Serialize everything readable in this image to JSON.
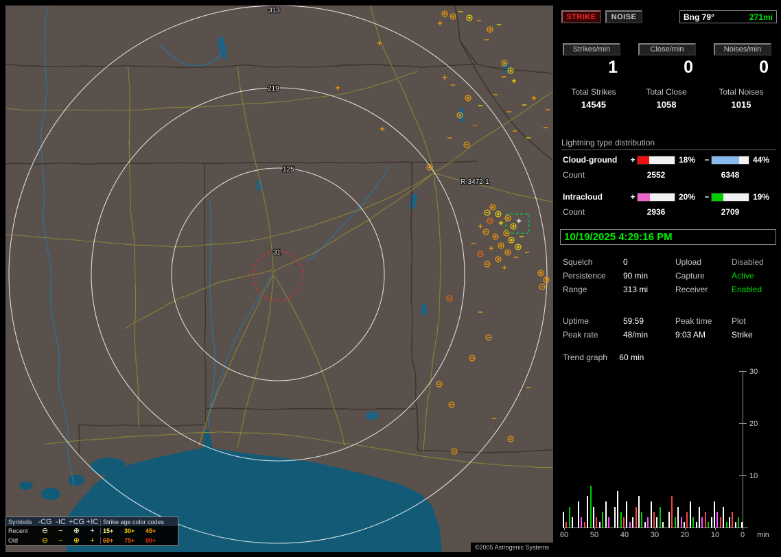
{
  "toolbar": {
    "strike_label": "STRIKE",
    "noise_label": "NOISE",
    "bearing": "Bng 79°",
    "distance": "271mi"
  },
  "rates": [
    {
      "label": "Strikes/min",
      "value": "1"
    },
    {
      "label": "Close/min",
      "value": "0"
    },
    {
      "label": "Noises/min",
      "value": "0"
    }
  ],
  "totals": [
    {
      "label": "Total Strikes",
      "value": "14545"
    },
    {
      "label": "Total Close",
      "value": "1058"
    },
    {
      "label": "Total Noises",
      "value": "1015"
    }
  ],
  "distribution": {
    "title": "Lightning type distribution",
    "count_label": "Count",
    "rows": [
      {
        "label": "Cloud-ground",
        "plus_sign": "+",
        "minus_sign": "−",
        "plus_pct_label": "18%",
        "plus_pct": 18,
        "plus_color": "#ee1111",
        "minus_pct_label": "44%",
        "minus_pct": 44,
        "minus_color": "#88bbee",
        "plus_count": "2552",
        "minus_count": "6348"
      },
      {
        "label": "Intracloud",
        "plus_sign": "+",
        "minus_sign": "−",
        "plus_pct_label": "20%",
        "plus_pct": 20,
        "plus_color": "#ee66cc",
        "minus_pct_label": "19%",
        "minus_pct": 19,
        "minus_color": "#00cc00",
        "plus_count": "2936",
        "minus_count": "2709"
      }
    ]
  },
  "clock": "10/19/2025 4:29:16 PM",
  "settings": {
    "rows": [
      [
        {
          "label": "Squelch",
          "value": "0",
          "cls": "val"
        },
        {
          "label": "Upload",
          "value": "Disabled",
          "cls": "val-gray"
        }
      ],
      [
        {
          "label": "Persistence",
          "value": "90 min",
          "cls": "val"
        },
        {
          "label": "Capture",
          "value": "Active",
          "cls": "val-green"
        }
      ],
      [
        {
          "label": "Range",
          "value": "313 mi",
          "cls": "val"
        },
        {
          "label": "Receiver",
          "value": "Enabled",
          "cls": "val-green"
        }
      ]
    ]
  },
  "session": {
    "rows": [
      [
        {
          "t": "Uptime",
          "c": "lbl"
        },
        {
          "t": "59:59",
          "c": "val"
        },
        {
          "t": "Peak time",
          "c": "lbl"
        },
        {
          "t": "Plot",
          "c": "lbl"
        }
      ],
      [
        {
          "t": "Peak rate",
          "c": "lbl"
        },
        {
          "t": "48/min",
          "c": "val"
        },
        {
          "t": "9:03 AM",
          "c": "val"
        },
        {
          "t": "Strike",
          "c": "val"
        }
      ]
    ]
  },
  "trend": {
    "label": "Trend graph",
    "window": "60 min"
  },
  "chart_data": {
    "type": "bar",
    "title": "Trend graph (strikes per minute, last 60 min)",
    "xlabel": "min",
    "x_ticks": [
      "60",
      "50",
      "40",
      "30",
      "20",
      "10",
      "0"
    ],
    "x_unit": "min",
    "y_ticks": [
      "10",
      "20",
      "30"
    ],
    "ylim": [
      0,
      30
    ],
    "series_colors": [
      "#ffffff",
      "#ff4040",
      "#00cc00",
      "#ff50ff"
    ],
    "bars": [
      [
        3,
        0
      ],
      [
        1,
        1
      ],
      [
        4,
        2
      ],
      [
        2,
        0
      ],
      [
        0,
        0
      ],
      [
        5,
        0
      ],
      [
        2,
        3
      ],
      [
        1,
        1
      ],
      [
        6,
        0
      ],
      [
        8,
        2
      ],
      [
        4,
        0
      ],
      [
        2,
        1
      ],
      [
        1,
        0
      ],
      [
        3,
        2
      ],
      [
        5,
        0
      ],
      [
        2,
        3
      ],
      [
        0,
        0
      ],
      [
        4,
        0
      ],
      [
        7,
        0
      ],
      [
        3,
        2
      ],
      [
        2,
        1
      ],
      [
        5,
        0
      ],
      [
        1,
        3
      ],
      [
        2,
        0
      ],
      [
        4,
        1
      ],
      [
        6,
        0
      ],
      [
        3,
        2
      ],
      [
        1,
        0
      ],
      [
        2,
        3
      ],
      [
        5,
        0
      ],
      [
        3,
        1
      ],
      [
        2,
        0
      ],
      [
        4,
        2
      ],
      [
        1,
        0
      ],
      [
        0,
        0
      ],
      [
        3,
        0
      ],
      [
        6,
        1
      ],
      [
        2,
        2
      ],
      [
        4,
        0
      ],
      [
        2,
        3
      ],
      [
        1,
        0
      ],
      [
        3,
        1
      ],
      [
        5,
        0
      ],
      [
        2,
        2
      ],
      [
        1,
        0
      ],
      [
        4,
        0
      ],
      [
        2,
        3
      ],
      [
        3,
        1
      ],
      [
        1,
        2
      ],
      [
        2,
        0
      ],
      [
        5,
        0
      ],
      [
        3,
        3
      ],
      [
        2,
        1
      ],
      [
        4,
        0
      ],
      [
        1,
        2
      ],
      [
        2,
        0
      ],
      [
        3,
        1
      ],
      [
        1,
        0
      ],
      [
        2,
        2
      ],
      [
        1,
        0
      ]
    ]
  },
  "map": {
    "rings": {
      "labels": [
        "313",
        "219",
        "125",
        "31"
      ]
    },
    "storm_label": "R-3472-1",
    "copyright": "©2005 Astrogenic Systems",
    "strike_colors": [
      "#ffffff",
      "#ffe000",
      "#ffa500",
      "#ff6a00",
      "#ff3000"
    ],
    "strikes": [
      [
        640,
        12,
        2,
        2
      ],
      [
        652,
        16,
        2,
        2
      ],
      [
        663,
        9,
        1,
        1
      ],
      [
        676,
        18,
        2,
        1
      ],
      [
        690,
        22,
        1,
        2
      ],
      [
        633,
        26,
        3,
        2
      ],
      [
        706,
        35,
        2,
        2
      ],
      [
        719,
        28,
        1,
        1
      ],
      [
        701,
        50,
        1,
        2
      ],
      [
        727,
        84,
        2,
        2
      ],
      [
        736,
        95,
        2,
        1
      ],
      [
        726,
        104,
        1,
        2
      ],
      [
        741,
        110,
        3,
        1
      ],
      [
        545,
        55,
        3,
        2
      ],
      [
        484,
        120,
        3,
        2
      ],
      [
        549,
        180,
        3,
        2
      ],
      [
        640,
        105,
        3,
        2
      ],
      [
        652,
        116,
        1,
        2
      ],
      [
        674,
        135,
        2,
        2
      ],
      [
        692,
        146,
        1,
        1
      ],
      [
        714,
        130,
        1,
        2
      ],
      [
        662,
        160,
        2,
        2
      ],
      [
        684,
        175,
        1,
        3
      ],
      [
        734,
        155,
        1,
        2
      ],
      [
        756,
        145,
        1,
        1
      ],
      [
        770,
        135,
        3,
        2
      ],
      [
        790,
        152,
        1,
        2
      ],
      [
        647,
        193,
        1,
        2
      ],
      [
        672,
        203,
        0,
        2
      ],
      [
        742,
        183,
        1,
        2
      ],
      [
        762,
        193,
        1,
        1
      ],
      [
        787,
        178,
        1,
        2
      ],
      [
        618,
        236,
        2,
        2
      ],
      [
        702,
        302,
        0,
        1
      ],
      [
        710,
        294,
        2,
        2
      ],
      [
        718,
        304,
        2,
        1
      ],
      [
        706,
        314,
        0,
        3
      ],
      [
        722,
        317,
        3,
        1
      ],
      [
        732,
        310,
        2,
        2
      ],
      [
        740,
        322,
        2,
        1
      ],
      [
        748,
        314,
        3,
        0
      ],
      [
        730,
        332,
        2,
        2
      ],
      [
        714,
        337,
        2,
        2
      ],
      [
        700,
        330,
        0,
        2
      ],
      [
        692,
        322,
        3,
        2
      ],
      [
        737,
        342,
        2,
        1
      ],
      [
        752,
        337,
        1,
        1
      ],
      [
        722,
        350,
        2,
        2
      ],
      [
        708,
        354,
        3,
        2
      ],
      [
        732,
        360,
        2,
        2
      ],
      [
        744,
        367,
        1,
        2
      ],
      [
        718,
        370,
        2,
        2
      ],
      [
        702,
        377,
        0,
        2
      ],
      [
        727,
        382,
        3,
        2
      ],
      [
        692,
        362,
        0,
        3
      ],
      [
        682,
        347,
        1,
        2
      ],
      [
        747,
        352,
        2,
        1
      ],
      [
        760,
        360,
        1,
        2
      ],
      [
        780,
        390,
        2,
        2
      ],
      [
        788,
        400,
        2,
        2
      ],
      [
        782,
        410,
        0,
        2
      ],
      [
        647,
        427,
        0,
        3
      ],
      [
        692,
        447,
        1,
        2
      ],
      [
        704,
        484,
        0,
        2
      ],
      [
        680,
        514,
        0,
        2
      ],
      [
        632,
        552,
        0,
        2
      ],
      [
        650,
        582,
        0,
        2
      ],
      [
        654,
        650,
        0,
        2
      ],
      [
        712,
        602,
        1,
        2
      ],
      [
        762,
        557,
        1,
        2
      ],
      [
        736,
        632,
        0,
        2
      ]
    ],
    "legend": {
      "header_symbols": "Symbols",
      "col_headers": [
        "-CG",
        "-IC",
        "+CG",
        "+IC"
      ],
      "age_header": "Strike age color codes",
      "symbols": [
        "⊖",
        "−",
        "⊕",
        "+"
      ],
      "rows": [
        {
          "label": "Recent",
          "symbol_color": "#f2f2c8"
        },
        {
          "label": "Old",
          "symbol_color": "#ffd800"
        }
      ],
      "age_codes_recent": [
        {
          "label": "15+",
          "color": "#fff780"
        },
        {
          "label": "30+",
          "color": "#ffd400"
        },
        {
          "label": "45+",
          "color": "#ffaa00"
        }
      ],
      "age_codes_old": [
        {
          "label": "60+",
          "color": "#ff8800"
        },
        {
          "label": "75+",
          "color": "#ff5500"
        },
        {
          "label": "90+",
          "color": "#ff2a00"
        }
      ]
    }
  }
}
